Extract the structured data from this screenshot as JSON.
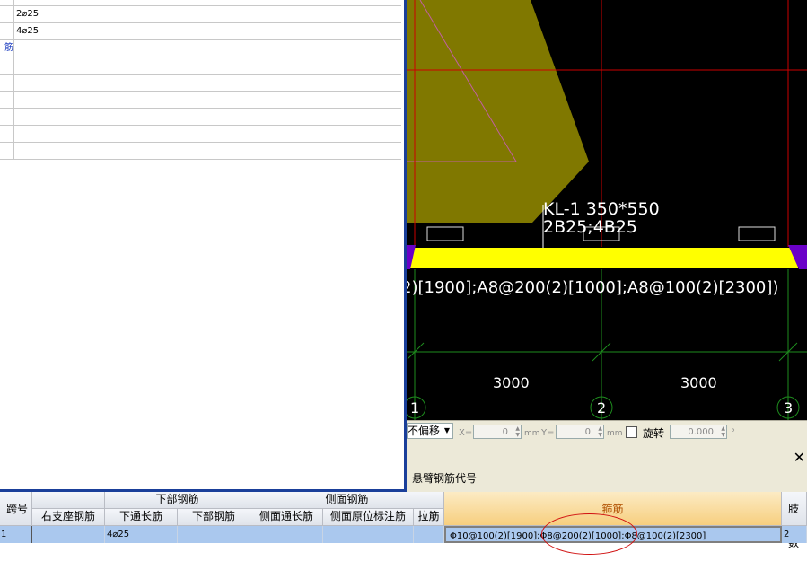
{
  "properties": {
    "rows": [
      {
        "key": "",
        "value": "2⌀25"
      },
      {
        "key": "",
        "value": "4⌀25"
      },
      {
        "key": "筋",
        "value": ""
      },
      {
        "key": "",
        "value": ""
      },
      {
        "key": "",
        "value": ""
      },
      {
        "key": "",
        "value": ""
      },
      {
        "key": "",
        "value": ""
      },
      {
        "key": "",
        "value": ""
      },
      {
        "key": "",
        "value": ""
      }
    ]
  },
  "cad": {
    "beam_label_line1": "KL-1 350*550",
    "beam_label_line2": "2B25;4B25",
    "stirrup_text": "2)[1900];A8@200(2)[1000];A8@100(2)[2300])",
    "dim_1": "3000",
    "dim_2": "3000",
    "axis_1": "1",
    "axis_2": "2",
    "axis_3": "3",
    "colors": {
      "beam": "#ffff00",
      "slab": "#807800",
      "axis_red": "#cc0000",
      "grid_green": "#1e8c1e"
    }
  },
  "toolbar": {
    "offset_select": "不偏移",
    "x_label": "X=",
    "x_value": "0",
    "x_unit": "mm",
    "y_label": "Y=",
    "y_value": "0",
    "y_unit": "mm",
    "rotate_label": "旋转",
    "rotate_value": "0.000",
    "rotate_unit": "°"
  },
  "panel": {
    "close_glyph": "✕",
    "tab_label": "悬臂钢筋代号"
  },
  "grid": {
    "headers": {
      "span_no": "跨号",
      "bottom_group": "下部钢筋",
      "side_group": "侧面钢筋",
      "right_support": "右支座钢筋",
      "bottom_through": "下通长筋",
      "bottom_bar": "下部钢筋",
      "side_through": "侧面通长筋",
      "side_original": "侧面原位标注筋",
      "tie_bar": "拉筋",
      "stirrup": "箍筋",
      "legs": "肢数"
    },
    "row": {
      "span_no": "1",
      "right_support": "",
      "bottom_through": "4⌀25",
      "bottom_bar": "",
      "side_through": "",
      "side_original": "",
      "tie_bar": "",
      "stirrup": "Φ10@100(2)[1900];Φ8@200(2)[1000];Φ8@100(2)[2300]",
      "legs": "2"
    }
  }
}
